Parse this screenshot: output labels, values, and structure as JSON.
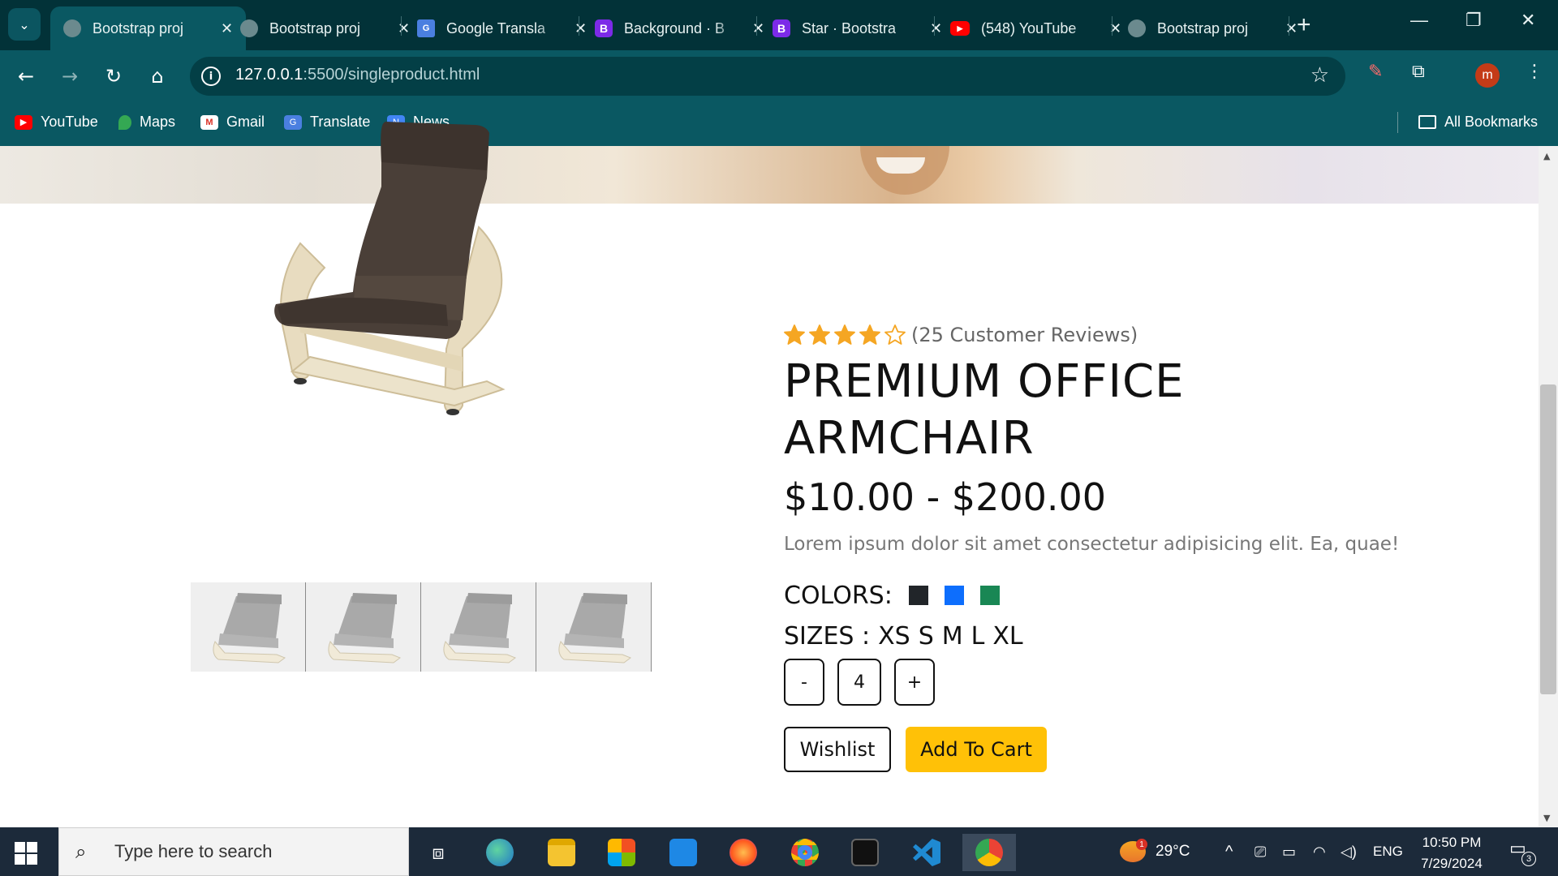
{
  "browser": {
    "tabs": [
      {
        "title": "Bootstrap proj",
        "favicon": "globe-icon",
        "active": true
      },
      {
        "title": "Bootstrap proj",
        "favicon": "globe-icon",
        "active": false
      },
      {
        "title": "Google Transla",
        "favicon": "google-translate-icon",
        "active": false
      },
      {
        "title": "Background · B",
        "favicon": "bootstrap-icon",
        "active": false
      },
      {
        "title": "Star · Bootstra",
        "favicon": "bootstrap-icon",
        "active": false
      },
      {
        "title": "(548) YouTube",
        "favicon": "youtube-icon",
        "active": false
      },
      {
        "title": "Bootstrap proj",
        "favicon": "globe-icon",
        "active": false
      }
    ],
    "url_host": "127.0.0.1",
    "url_path": ":5500/singleproduct.html",
    "profile_initial": "m",
    "bookmarks": [
      "YouTube",
      "Maps",
      "Gmail",
      "Translate",
      "News"
    ],
    "all_bookmarks_label": "All Bookmarks"
  },
  "product": {
    "rating": 4,
    "rating_max": 5,
    "reviews_text": "(25 Customer Reviews)",
    "title": "PREMIUM OFFICE ARMCHAIR",
    "price": "$10.00 - $200.00",
    "description": "Lorem ipsum dolor sit amet consectetur adipisicing elit. Ea, quae!",
    "colors_label": "COLORS:",
    "colors": [
      "#212529",
      "#0d6efd",
      "#198754"
    ],
    "sizes_label": "SIZES :",
    "sizes": [
      "XS",
      "S",
      "M",
      "L",
      "XL"
    ],
    "qty_minus": "-",
    "qty_value": "4",
    "qty_plus": "+",
    "wishlist_label": "Wishlist",
    "add_to_cart_label": "Add To Cart",
    "thumbnail_count": 4
  },
  "taskbar": {
    "search_placeholder": "Type here to search",
    "weather_temp": "29°C",
    "weather_badge": "1",
    "language": "ENG",
    "time": "10:50 PM",
    "date": "7/29/2024",
    "notification_count": "3"
  },
  "colors": {
    "tab_strip": "#023238",
    "toolbar": "#0a5862",
    "accent_yellow": "#ffc107",
    "star_color": "#f5a623"
  }
}
